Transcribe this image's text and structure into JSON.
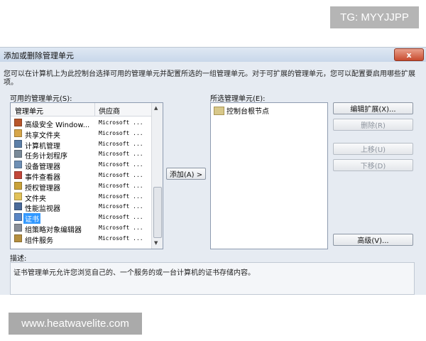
{
  "watermarks": {
    "top": "TG: MYYJJPP",
    "bottom": "www.heatwavelite.com"
  },
  "dialog": {
    "title": "添加或删除管理单元",
    "close_label": "x",
    "description": "您可以在计算机上为此控制台选择可用的管理单元并配置所选的一组管理单元。对于可扩展的管理单元，您可以配置要启用哪些扩展项。"
  },
  "available": {
    "label": "可用的管理单元(S):",
    "columns": [
      "管理单元",
      "供应商"
    ],
    "items": [
      {
        "name": "高级安全 Window...",
        "vendor": "Microsoft ...",
        "icon": "firewall-icon",
        "color": "#b8562b"
      },
      {
        "name": "共享文件夹",
        "vendor": "Microsoft ...",
        "icon": "shared-folder-icon",
        "color": "#d6a64a"
      },
      {
        "name": "计算机管理",
        "vendor": "Microsoft ...",
        "icon": "computer-management-icon",
        "color": "#5c7fa8"
      },
      {
        "name": "任务计划程序",
        "vendor": "Microsoft ...",
        "icon": "task-scheduler-icon",
        "color": "#7a8a99"
      },
      {
        "name": "设备管理器",
        "vendor": "Microsoft ...",
        "icon": "device-manager-icon",
        "color": "#6e8fb5"
      },
      {
        "name": "事件查看器",
        "vendor": "Microsoft ...",
        "icon": "event-viewer-icon",
        "color": "#c2473a"
      },
      {
        "name": "授权管理器",
        "vendor": "Microsoft ...",
        "icon": "authorization-manager-icon",
        "color": "#c9a23a"
      },
      {
        "name": "文件夹",
        "vendor": "Microsoft ...",
        "icon": "folder-icon",
        "color": "#e2c25a"
      },
      {
        "name": "性能监视器",
        "vendor": "Microsoft ...",
        "icon": "performance-monitor-icon",
        "color": "#4a6a9a"
      },
      {
        "name": "证书",
        "vendor": "Microsoft ...",
        "icon": "certificate-icon",
        "color": "#5a86c5"
      },
      {
        "name": "组策略对象编辑器",
        "vendor": "Microsoft ...",
        "icon": "group-policy-icon",
        "color": "#8a8f98"
      },
      {
        "name": "组件服务",
        "vendor": "Microsoft ...",
        "icon": "component-services-icon",
        "color": "#b68f3f"
      }
    ],
    "selected_index": 9
  },
  "add_button": "添加(A) >",
  "selected": {
    "label": "所选管理单元(E):",
    "root": "控制台根节点"
  },
  "buttons": {
    "edit_extensions": "编辑扩展(X)...",
    "remove": "删除(R)",
    "move_up": "上移(U)",
    "move_down": "下移(D)",
    "advanced": "高级(V)..."
  },
  "description_section": {
    "label": "描述:",
    "text": "证书管理单元允许您浏览自己的、一个服务的或一台计算机的证书存储内容。"
  }
}
